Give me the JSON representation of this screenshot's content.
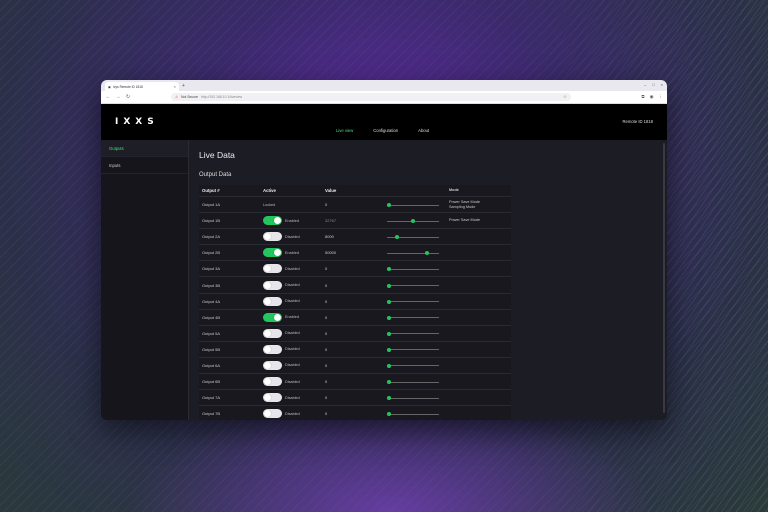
{
  "browser": {
    "tab_title": "Ixys Remote ID 1818",
    "new_tab": "+",
    "security_label": "Not Secure",
    "url": "http://192.168.10.1/liveview",
    "nav_back": "←",
    "nav_forward": "→",
    "nav_reload": "↻",
    "star": "☆"
  },
  "app": {
    "logo": "IXXS",
    "nav": [
      "Live view",
      "Configuration",
      "About"
    ],
    "device_id": "Remote ID 1818"
  },
  "sidebar": {
    "items": [
      {
        "label": "Outputs"
      },
      {
        "label": "Inputs"
      }
    ]
  },
  "main": {
    "title": "Live Data",
    "section": "Output Data",
    "headers": [
      "Output #",
      "Active",
      "Value",
      "",
      "Mode"
    ],
    "modes": [
      "Power Save Mode",
      "Sampling Mode",
      "Power Save Mode"
    ],
    "rows": [
      {
        "name": "Output 1A",
        "state": "locked",
        "label": "Locked",
        "value": "0",
        "level": 0.03
      },
      {
        "name": "Output 1B",
        "state": "on",
        "label": "Enabled",
        "value": "32767",
        "level": 0.5
      },
      {
        "name": "Output 2A",
        "state": "off",
        "label": "Disabled",
        "value": "8000",
        "level": 0.2
      },
      {
        "name": "Output 2B",
        "state": "on",
        "label": "Enabled",
        "value": "50000",
        "level": 0.76
      },
      {
        "name": "Output 3A",
        "state": "off",
        "label": "Disabled",
        "value": "0",
        "level": 0.03
      },
      {
        "name": "Output 3B",
        "state": "off",
        "label": "Disabled",
        "value": "0",
        "level": 0.03
      },
      {
        "name": "Output 4A",
        "state": "off",
        "label": "Disabled",
        "value": "0",
        "level": 0.03
      },
      {
        "name": "Output 4B",
        "state": "on",
        "label": "Enabled",
        "value": "0",
        "level": 0.03
      },
      {
        "name": "Output 5A",
        "state": "off",
        "label": "Disabled",
        "value": "0",
        "level": 0.03
      },
      {
        "name": "Output 5B",
        "state": "off",
        "label": "Disabled",
        "value": "0",
        "level": 0.03
      },
      {
        "name": "Output 6A",
        "state": "off",
        "label": "Disabled",
        "value": "0",
        "level": 0.03
      },
      {
        "name": "Output 6B",
        "state": "off",
        "label": "Disabled",
        "value": "0",
        "level": 0.03
      },
      {
        "name": "Output 7A",
        "state": "off",
        "label": "Disabled",
        "value": "0",
        "level": 0.03
      },
      {
        "name": "Output 7B",
        "state": "off",
        "label": "Disabled",
        "value": "0",
        "level": 0.03
      }
    ]
  },
  "colors": {
    "accent": "#22c55e",
    "nav_active": "#4ade80"
  }
}
